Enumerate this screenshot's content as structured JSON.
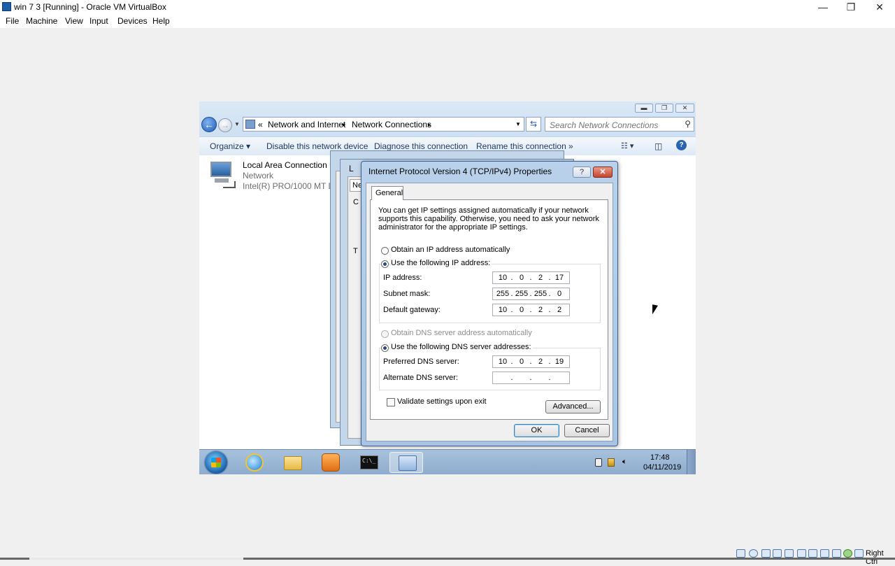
{
  "host": {
    "title": "win 7 3 [Running] - Oracle VM VirtualBox",
    "menu": [
      "File",
      "Machine",
      "View",
      "Input",
      "Devices",
      "Help"
    ],
    "window_controls": {
      "minimize": "—",
      "restore": "❐",
      "close": "✕"
    },
    "status": {
      "host_key": "Right Ctrl"
    }
  },
  "explorer": {
    "address": {
      "prefix": "«",
      "crumbs": [
        "Network and Internet",
        "Network Connections"
      ],
      "sep": "▸"
    },
    "search_placeholder": "Search Network Connections",
    "commands": {
      "organize": "Organize ▾",
      "disable": "Disable this network device",
      "diagnose": "Diagnose this connection",
      "rename": "Rename this connection",
      "more": "»"
    },
    "connection": {
      "name": "Local Area Connection",
      "type": "Network",
      "device": "Intel(R) PRO/1000 MT Desk"
    }
  },
  "bg_dialogs": {
    "title_fragment": "L",
    "tab_fragment": "Ne",
    "frag_c": "C",
    "frag_t": "T"
  },
  "ipv4": {
    "title": "Internet Protocol Version 4 (TCP/IPv4) Properties",
    "help": "?",
    "close": "✕",
    "tab": "General",
    "intro": "You can get IP settings assigned automatically if your network supports this capability. Otherwise, you need to ask your network administrator for the appropriate IP settings.",
    "radio_auto_ip": "Obtain an IP address automatically",
    "radio_manual_ip": "Use the following IP address:",
    "ip_label": "IP address:",
    "ip": [
      "10",
      "0",
      "2",
      "17"
    ],
    "mask_label": "Subnet mask:",
    "mask": [
      "255",
      "255",
      "255",
      "0"
    ],
    "gw_label": "Default gateway:",
    "gw": [
      "10",
      "0",
      "2",
      "2"
    ],
    "radio_auto_dns": "Obtain DNS server address automatically",
    "radio_manual_dns": "Use the following DNS server addresses:",
    "pdns_label": "Preferred DNS server:",
    "pdns": [
      "10",
      "0",
      "2",
      "19"
    ],
    "adns_label": "Alternate DNS server:",
    "adns": [
      "",
      "",
      "",
      ""
    ],
    "validate": "Validate settings upon exit",
    "advanced": "Advanced...",
    "ok": "OK",
    "cancel": "Cancel"
  },
  "taskbar": {
    "time": "17:48",
    "date": "04/11/2019"
  }
}
